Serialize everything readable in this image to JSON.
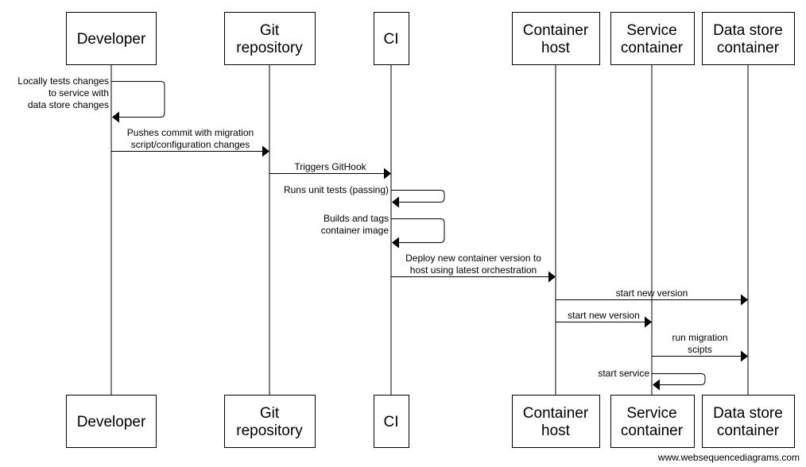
{
  "diagram": {
    "type": "sequence",
    "participants": [
      {
        "id": "dev",
        "lines": [
          "Developer"
        ]
      },
      {
        "id": "git",
        "lines": [
          "Git",
          "repository"
        ]
      },
      {
        "id": "ci",
        "lines": [
          "CI"
        ]
      },
      {
        "id": "host",
        "lines": [
          "Container",
          "host"
        ]
      },
      {
        "id": "svc",
        "lines": [
          "Service",
          "container"
        ]
      },
      {
        "id": "db",
        "lines": [
          "Data store",
          "container"
        ]
      }
    ],
    "messages": [
      {
        "from": "dev",
        "to": "dev",
        "lines": [
          "Locally tests changes",
          "to service with",
          "data store changes"
        ]
      },
      {
        "from": "dev",
        "to": "git",
        "lines": [
          "Pushes commit with migration",
          "script/configuration changes"
        ]
      },
      {
        "from": "git",
        "to": "ci",
        "lines": [
          "Triggers GitHook"
        ]
      },
      {
        "from": "ci",
        "to": "ci",
        "lines": [
          "Runs unit tests (passing)"
        ]
      },
      {
        "from": "ci",
        "to": "ci",
        "lines": [
          "Builds and tags",
          "container image"
        ]
      },
      {
        "from": "ci",
        "to": "host",
        "lines": [
          "Deploy new container version to",
          "host using latest orchestration"
        ]
      },
      {
        "from": "host",
        "to": "db",
        "lines": [
          "start new version"
        ]
      },
      {
        "from": "host",
        "to": "svc",
        "lines": [
          "start new version"
        ]
      },
      {
        "from": "svc",
        "to": "db",
        "lines": [
          "run migration",
          "scipts"
        ]
      },
      {
        "from": "svc",
        "to": "svc",
        "lines": [
          "start service"
        ]
      }
    ]
  },
  "footer": {
    "watermark": "www.websequencediagrams.com"
  }
}
